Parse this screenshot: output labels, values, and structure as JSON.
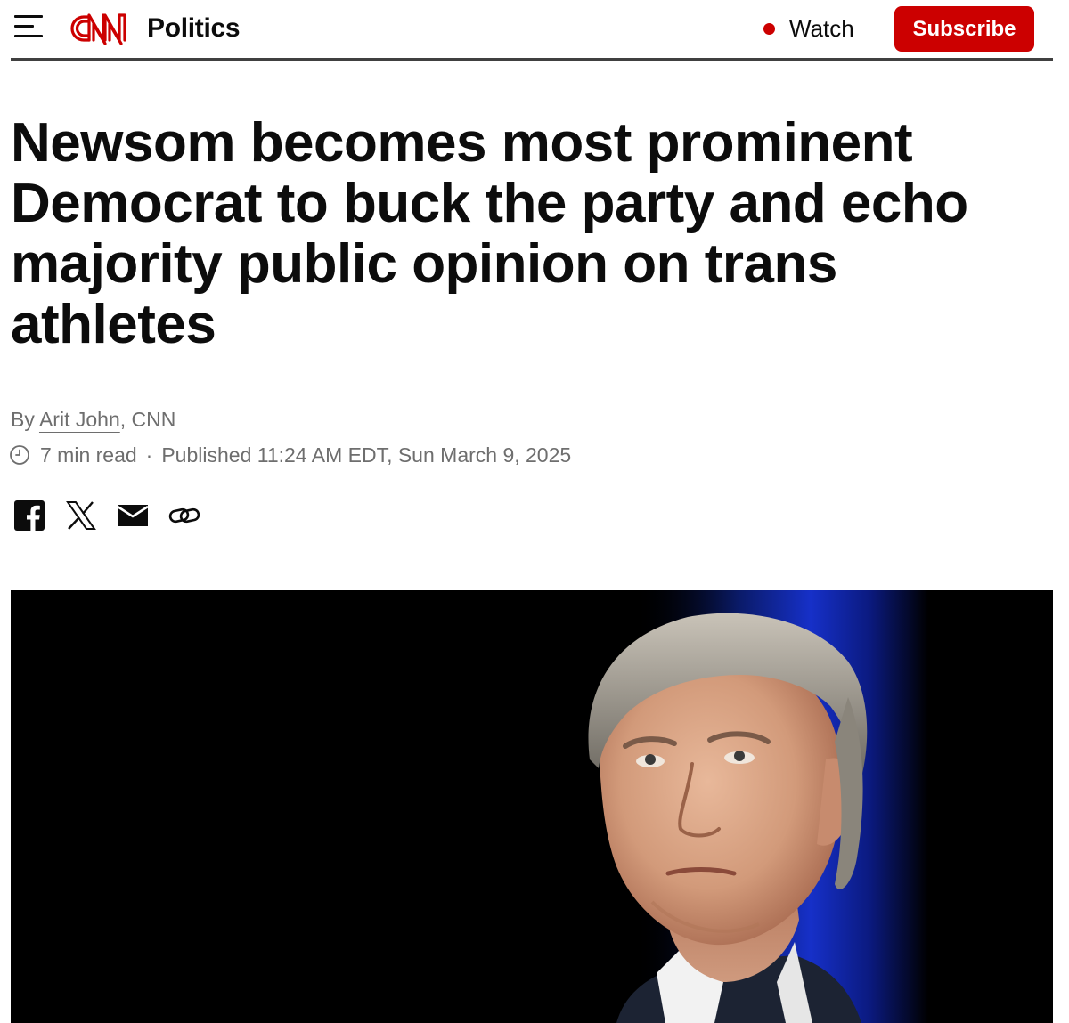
{
  "header": {
    "menu_icon": "hamburger-icon",
    "logo_text": "CNN",
    "section": "Politics",
    "watch_label": "Watch",
    "subscribe_label": "Subscribe",
    "brand_color": "#cc0000"
  },
  "article": {
    "headline": "Newsom becomes most prominent Democrat to buck the party and echo majority public opinion on trans athletes",
    "byline_prefix": "By ",
    "author": "Arit John",
    "byline_suffix": ", CNN",
    "read_time": "7 min read",
    "separator": "·",
    "published": "Published 11:24 AM EDT, Sun March 9, 2025"
  },
  "share": {
    "icons": [
      "facebook-icon",
      "x-icon",
      "email-icon",
      "link-icon"
    ]
  },
  "hero_image": {
    "subject": "photo-of-man-looking-up"
  }
}
